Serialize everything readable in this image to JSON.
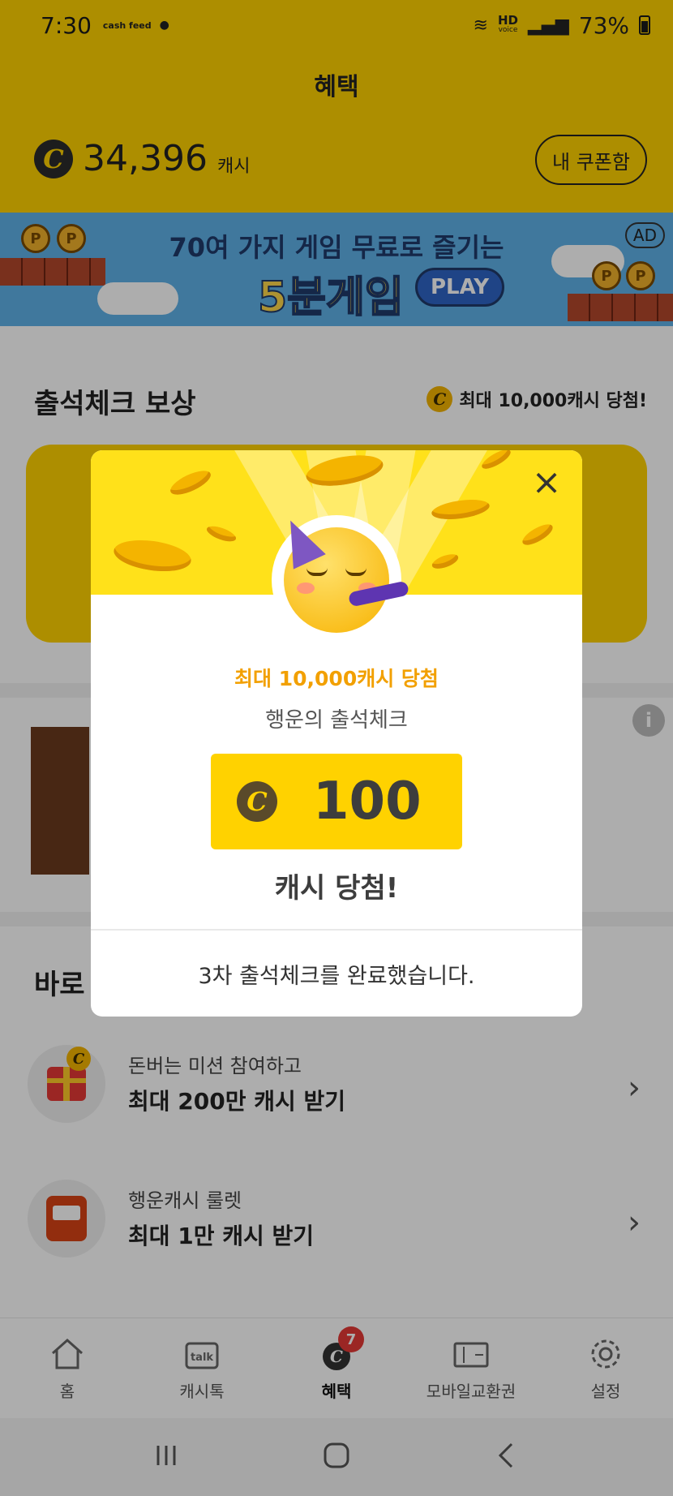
{
  "status_bar": {
    "time": "7:30",
    "cashfeed_label": "cash feed",
    "network_label": "HD",
    "network_sub": "voice",
    "battery": "73%"
  },
  "header": {
    "title": "혜택",
    "balance_symbol": "C",
    "balance": "34,396",
    "balance_unit": "캐시",
    "coupon_button": "내 쿠폰함"
  },
  "banner": {
    "line1": "70여 가지 게임 무료로 즐기는",
    "line2": "5분게임",
    "play": "PLAY",
    "ad": "AD",
    "coin_letter": "P"
  },
  "attendance": {
    "title": "출석체크 보상",
    "badge": "최대 10,000캐시 당첨!"
  },
  "shortcuts": {
    "title": "바로",
    "items": [
      {
        "sub": "돈버는 미션 참여하고",
        "main": "최대 200만 캐시 받기",
        "icon": "gift-icon"
      },
      {
        "sub": "행운캐시 룰렛",
        "main": "최대 1만 캐시 받기",
        "icon": "slot-machine-icon"
      }
    ]
  },
  "bottom_nav": {
    "items": [
      {
        "label": "홈",
        "icon": "home-icon"
      },
      {
        "label": "캐시톡",
        "icon": "talk-icon"
      },
      {
        "label": "혜택",
        "icon": "benefit-icon",
        "badge": "7"
      },
      {
        "label": "모바일교환권",
        "icon": "voucher-icon"
      },
      {
        "label": "설정",
        "icon": "settings-icon"
      }
    ],
    "active_index": 2
  },
  "modal": {
    "max_label": "최대 10,000캐시 당첨",
    "lucky_label": "행운의 출석체크",
    "prize_amount": "100",
    "prize_symbol": "C",
    "won_label": "캐시 당첨!",
    "done_message": "3차 출석체크를 완료했습니다.",
    "close_icon": "close-icon"
  },
  "colors": {
    "brand_yellow": "#FFD200",
    "accent_orange": "#F2A000",
    "badge_red": "#E53935"
  }
}
